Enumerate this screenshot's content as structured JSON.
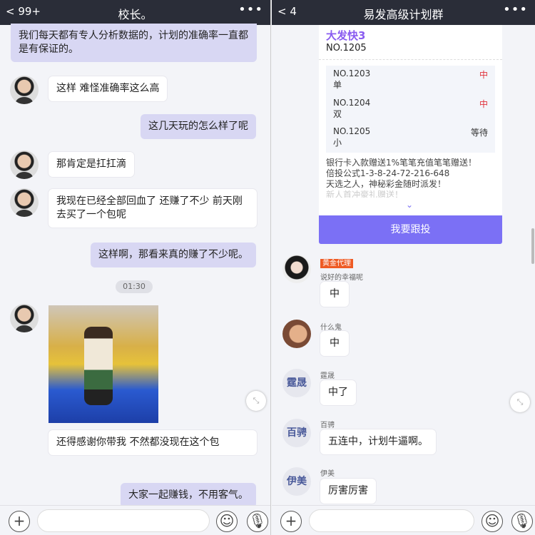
{
  "left": {
    "header": {
      "back_label": "99+",
      "title": "校长。",
      "more": "•••"
    },
    "messages": [
      {
        "side": "sent",
        "text": "我们每天都有专人分析数据的，计划的准确率一直都是有保证的。"
      },
      {
        "side": "received",
        "text": "这样 难怪准确率这么高"
      },
      {
        "side": "sent",
        "text": "这几天玩的怎么样了呢"
      },
      {
        "side": "received",
        "text": "那肯定是扛扛滴"
      },
      {
        "side": "received",
        "text": "我现在已经全部回血了 还赚了不少 前天刚去买了一个包呢"
      },
      {
        "side": "sent",
        "text": "这样啊，那看来真的赚了不少呢。"
      },
      {
        "side": "received",
        "text": "还得感谢你带我 不然都没现在这个包"
      },
      {
        "side": "sent",
        "text": "大家一起赚钱，不用客气。"
      }
    ],
    "time_divider": "01:30"
  },
  "right": {
    "header": {
      "back_label": "4",
      "title": "易发高级计划群",
      "more": "•••"
    },
    "card": {
      "game": "大发快3",
      "issue": "NO.1205",
      "records": [
        {
          "issue": "NO.1203",
          "pick": "单",
          "status": "中"
        },
        {
          "issue": "NO.1204",
          "pick": "双",
          "status": "中"
        },
        {
          "issue": "NO.1205",
          "pick": "小",
          "status": "等待"
        }
      ],
      "notes": [
        "银行卡入款赠送1%笔笔充值笔笔赠送！",
        "倍投公式1-3-8-24-72-216-648",
        "天选之人，神秘彩金随时派发！",
        "新人首冲豪礼赠送！"
      ],
      "button": "我要跟投"
    },
    "messages": [
      {
        "badge": "黄金代理",
        "name": "说好的幸福呢",
        "text": "中"
      },
      {
        "name": "什么鬼",
        "text": "中"
      },
      {
        "name": "霆晟",
        "avatar_text": "霆晟",
        "text": "中了"
      },
      {
        "name": "百骋",
        "avatar_text": "百骋",
        "text": "五连中，计划牛逼啊。"
      },
      {
        "name": "伊美",
        "avatar_text": "伊美",
        "text": "厉害厉害"
      }
    ]
  },
  "colors": {
    "header": "#2a2d38",
    "sent_bubble": "#d8d7f3",
    "accent": "#7b70f5",
    "win": "#e0303a",
    "badge": "#ee5a24"
  }
}
